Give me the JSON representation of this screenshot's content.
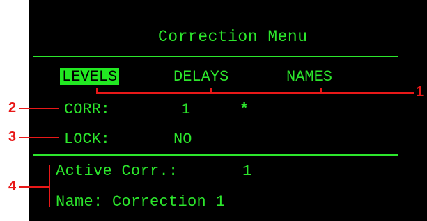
{
  "screen": {
    "title": "Correction Menu",
    "tabs": [
      {
        "label": "LEVELS",
        "selected": true
      },
      {
        "label": "DELAYS",
        "selected": false
      },
      {
        "label": "NAMES",
        "selected": false
      }
    ],
    "corr": {
      "label": "CORR:",
      "value": "1",
      "marker": "*"
    },
    "lock": {
      "label": "LOCK:",
      "value": "NO"
    },
    "active": {
      "label": "Active Corr.:",
      "value": "1"
    },
    "name": {
      "label": "Name:",
      "value": "Correction 1"
    }
  },
  "callouts": [
    "1",
    "2",
    "3",
    "4"
  ],
  "colors": {
    "text": "#2ce62c",
    "highlight": "#22e822",
    "background": "#000000",
    "callout": "#e81818"
  }
}
